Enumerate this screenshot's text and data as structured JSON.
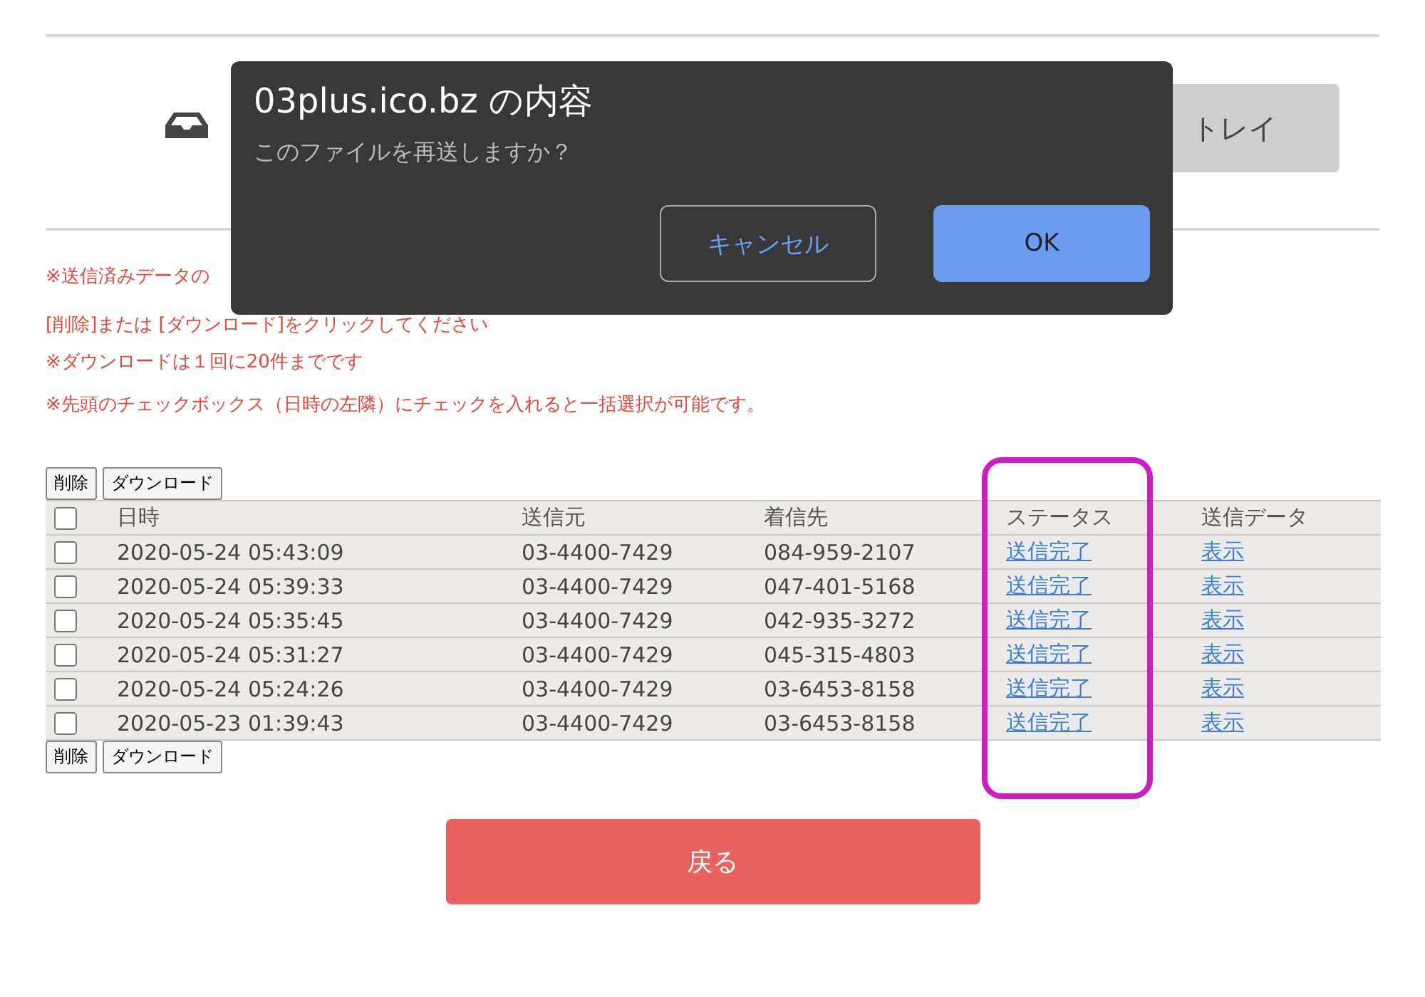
{
  "tray_button": {
    "label": "トレイ"
  },
  "notes": [
    "※送信済みデータの",
    "[削除]または [ダウンロード]をクリックしてください",
    "※ダウンロードは１回に20件までです",
    "※先頭のチェックボックス（日時の左隣）にチェックを入れると一括選択が可能です。"
  ],
  "top_actions": [
    "削除",
    "ダウンロード"
  ],
  "table": {
    "select_all": {
      "checked": false
    },
    "columns": [
      "日時",
      "送信元",
      "着信先",
      "ステータス",
      "送信データ"
    ],
    "rows": [
      {
        "checked": false,
        "cells": [
          "2020-05-24 05:43:09",
          "03-4400-7429",
          "084-959-2107"
        ],
        "status": "送信完了",
        "data": "表示"
      },
      {
        "checked": false,
        "cells": [
          "2020-05-24 05:39:33",
          "03-4400-7429",
          "047-401-5168"
        ],
        "status": "送信完了",
        "data": "表示"
      },
      {
        "checked": false,
        "cells": [
          "2020-05-24 05:35:45",
          "03-4400-7429",
          "042-935-3272"
        ],
        "status": "送信完了",
        "data": "表示"
      },
      {
        "checked": false,
        "cells": [
          "2020-05-24 05:31:27",
          "03-4400-7429",
          "045-315-4803"
        ],
        "status": "送信完了",
        "data": "表示"
      },
      {
        "checked": false,
        "cells": [
          "2020-05-24 05:24:26",
          "03-4400-7429",
          "03-6453-8158"
        ],
        "status": "送信完了",
        "data": "表示"
      },
      {
        "checked": false,
        "cells": [
          "2020-05-23 01:39:43",
          "03-4400-7429",
          "03-6453-8158"
        ],
        "status": "送信完了",
        "data": "表示"
      }
    ]
  },
  "bottom_actions": [
    "削除",
    "ダウンロード"
  ],
  "back_button": {
    "label": "戻る"
  },
  "dialog": {
    "title": "03plus.ico.bz の内容",
    "message": "このファイルを再送しますか？",
    "buttons": [
      {
        "label": "キャンセル",
        "kind": "secondary"
      },
      {
        "label": "OK",
        "kind": "primary"
      }
    ]
  }
}
